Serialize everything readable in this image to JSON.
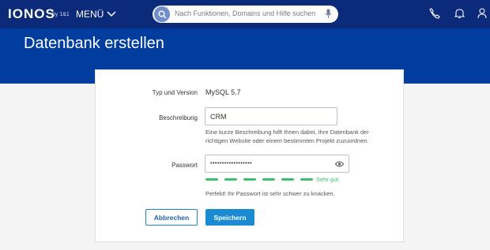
{
  "header": {
    "logo": "IONOS",
    "logo_sub": "by 1&1",
    "menu_label": "MENÜ",
    "search_placeholder": "Nach Funktionen, Domains und Hilfe suchen",
    "icons": [
      "phone-icon",
      "bell-icon",
      "user-icon"
    ]
  },
  "page": {
    "title": "Datenbank erstellen"
  },
  "form": {
    "type_label": "Typ und Version",
    "type_value": "MySQL 5.7",
    "desc_label": "Beschreibung",
    "desc_value": "CRM",
    "desc_hint_line1": "Eine kurze Beschreibung hilft Ihnen dabei, Ihre Datenbank der",
    "desc_hint_line2": "richtigen Website oder einem bestimmten Projekt zuzuordnen.",
    "password_label": "Passwort",
    "password_value": "••••••••••••••••••",
    "strength_label": "Sehr gut",
    "strength_segments": 6,
    "password_message": "Perfekt! Ihr Passwort ist sehr schwer zu knacken."
  },
  "actions": {
    "cancel_label": "Abbrechen",
    "save_label": "Speichern"
  },
  "colors": {
    "topbar": "#0b2a7a",
    "hero": "#003d9e",
    "accent": "#1a8bd0",
    "success": "#3dbf6b"
  }
}
